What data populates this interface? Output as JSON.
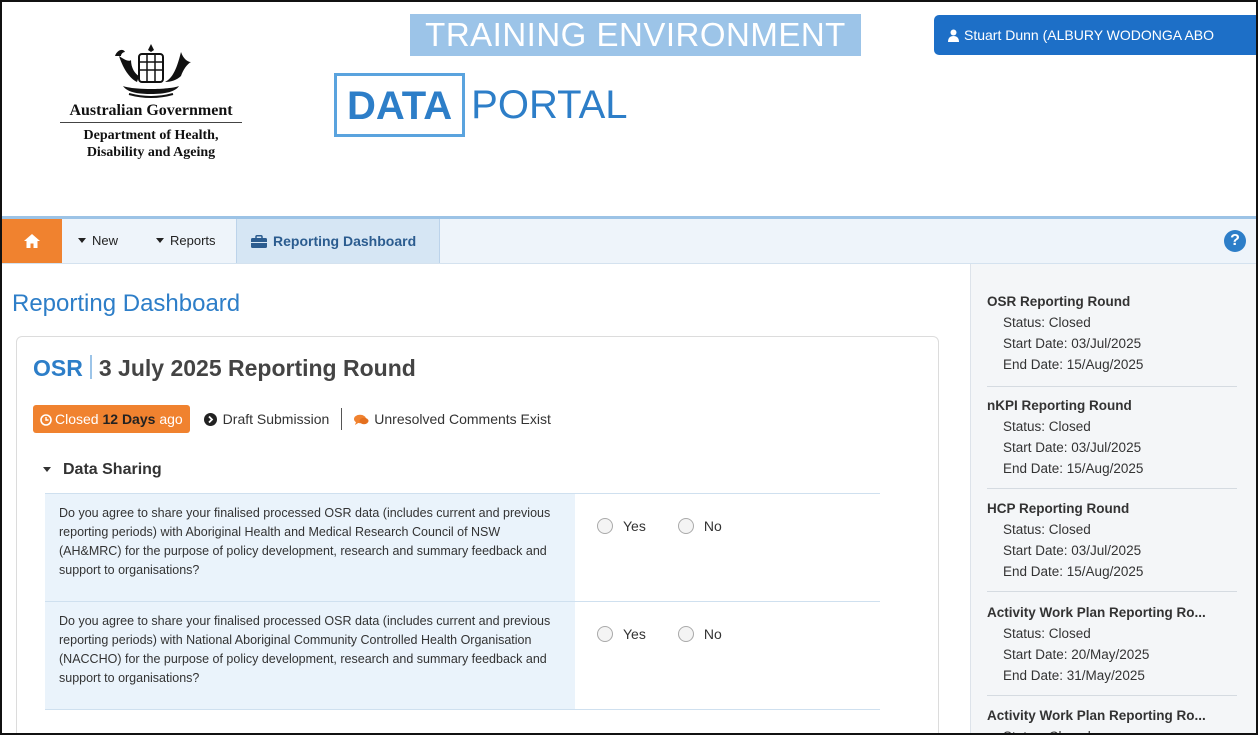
{
  "header": {
    "gov_name": "Australian Government",
    "dept_line1": "Department of Health,",
    "dept_line2": "Disability and Ageing",
    "environment_banner": "TRAINING ENVIRONMENT",
    "portal_data": "DATA",
    "portal_portal": "PORTAL",
    "user_label": "Stuart Dunn (ALBURY WODONGA ABO"
  },
  "nav": {
    "new_label": "New",
    "reports_label": "Reports",
    "dashboard_label": "Reporting Dashboard",
    "help_label": "?"
  },
  "main": {
    "page_title": "Reporting Dashboard",
    "card": {
      "title_prefix": "OSR",
      "title_rest": "3 July 2025 Reporting Round",
      "closed_text": "Closed",
      "closed_days": "12 Days",
      "closed_suffix": "ago",
      "draft_text": "Draft Submission",
      "comments_text": "Unresolved Comments Exist",
      "section_title": "Data Sharing",
      "questions": [
        {
          "text": "Do you agree to share your finalised processed OSR data (includes current and previous reporting periods) with Aboriginal Health and Medical Research Council of NSW (AH&MRC) for the purpose of policy development, research and summary feedback and support to organisations?",
          "yes": "Yes",
          "no": "No"
        },
        {
          "text": "Do you agree to share your finalised processed OSR data (includes current and previous reporting periods) with National Aboriginal Community Controlled Health Organisation (NACCHO) for the purpose of policy development, research and summary feedback and support to organisations?",
          "yes": "Yes",
          "no": "No"
        }
      ]
    }
  },
  "sidebar": {
    "rounds": [
      {
        "name": "OSR Reporting Round",
        "status": "Status: Closed",
        "start": "Start Date: 03/Jul/2025",
        "end": "End Date: 15/Aug/2025"
      },
      {
        "name": "nKPI Reporting Round",
        "status": "Status: Closed",
        "start": "Start Date: 03/Jul/2025",
        "end": "End Date: 15/Aug/2025"
      },
      {
        "name": "HCP Reporting Round",
        "status": "Status: Closed",
        "start": "Start Date: 03/Jul/2025",
        "end": "End Date: 15/Aug/2025"
      },
      {
        "name": "Activity Work Plan Reporting Ro...",
        "status": "Status: Closed",
        "start": "Start Date: 20/May/2025",
        "end": "End Date: 31/May/2025"
      },
      {
        "name": "Activity Work Plan Reporting Ro...",
        "status": "Status: Closed",
        "start": "",
        "end": ""
      }
    ]
  },
  "colors": {
    "accent_blue": "#2d7ec8",
    "orange": "#f0822f",
    "user_button": "#1d6fc7",
    "training_banner": "#9cc4e8"
  }
}
